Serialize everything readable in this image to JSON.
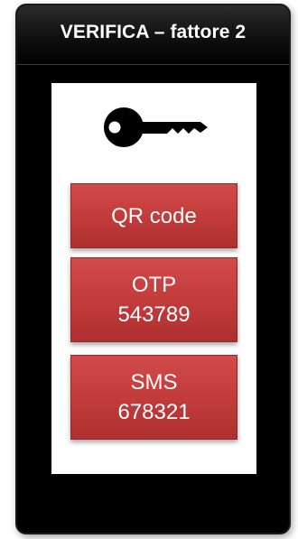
{
  "header": {
    "title": "VERIFICA – fattore 2"
  },
  "icon": {
    "name": "key-icon",
    "color": "#000000"
  },
  "options": {
    "qr": {
      "label": "QR code"
    },
    "otp": {
      "label": "OTP",
      "code": "543789"
    },
    "sms": {
      "label": "SMS",
      "code": "678321"
    }
  },
  "colors": {
    "button_red": "#c13b3b",
    "phone_body": "#000000",
    "screen": "#ffffff"
  }
}
